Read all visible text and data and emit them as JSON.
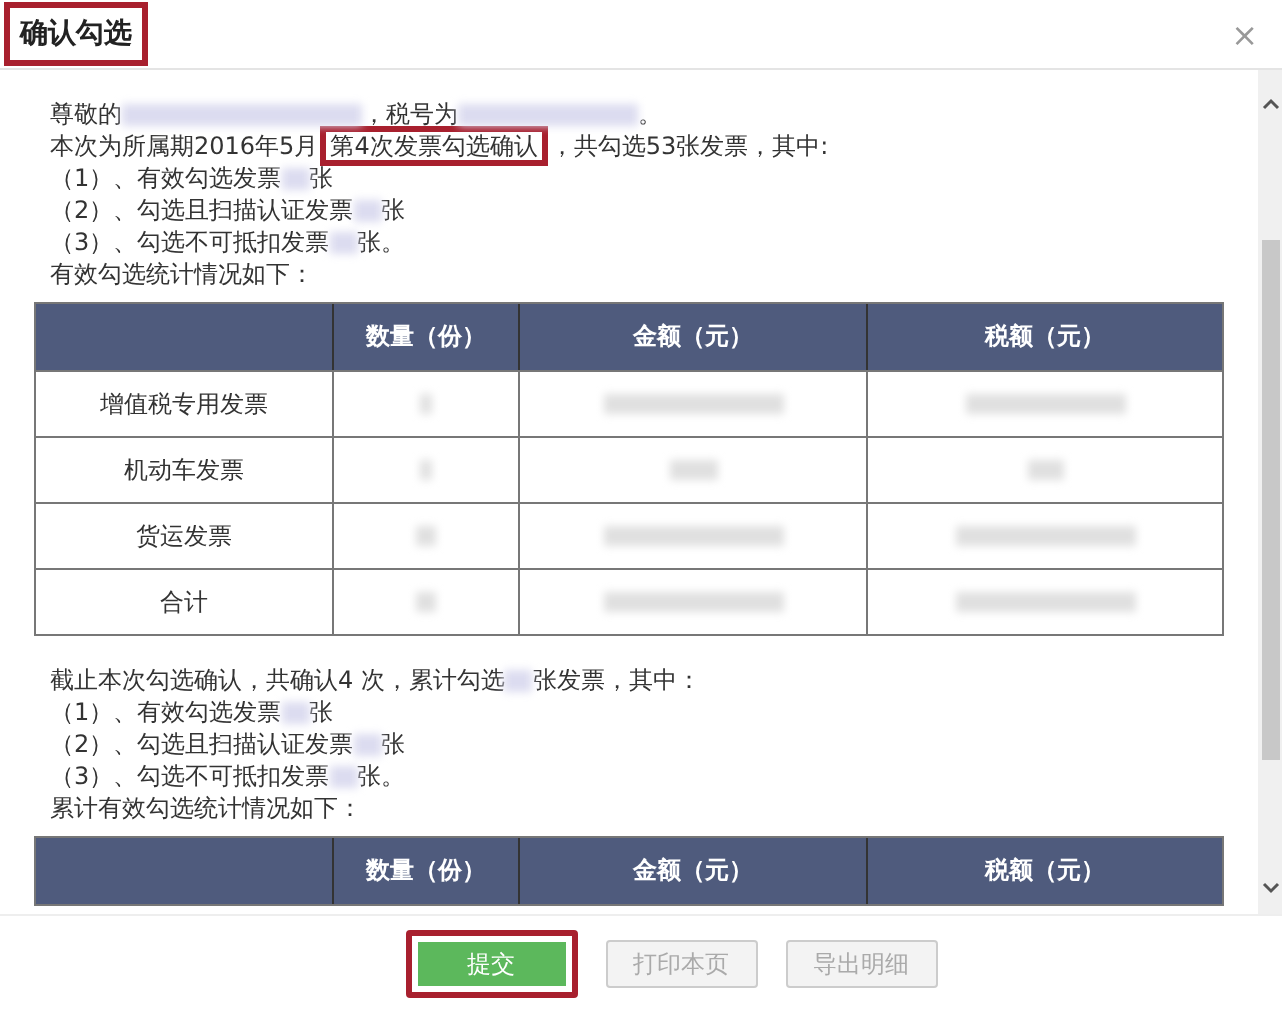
{
  "dialog": {
    "title": "确认勾选",
    "title_highlighted": true,
    "close": "×"
  },
  "section_1": {
    "lines": [
      [
        {
          "kind": "text",
          "text": "尊敬的"
        },
        {
          "kind": "redacted"
        },
        {
          "kind": "text",
          "text": "，税号为"
        },
        {
          "kind": "redacted"
        },
        {
          "kind": "text",
          "text": "。"
        }
      ],
      [
        {
          "kind": "text",
          "text": "本次为所属期2016年5月"
        },
        {
          "kind": "boxed",
          "text": "第4次发票勾选确认"
        },
        {
          "kind": "text",
          "text": "，共勾选53张发票，其中:"
        }
      ],
      [
        {
          "kind": "text",
          "text": "（1）、有效勾选发票"
        },
        {
          "kind": "redacted"
        },
        {
          "kind": "text",
          "text": "张"
        }
      ],
      [
        {
          "kind": "text",
          "text": "（2）、勾选且扫描认证发票"
        },
        {
          "kind": "redacted"
        },
        {
          "kind": "text",
          "text": "张"
        }
      ],
      [
        {
          "kind": "text",
          "text": "（3）、勾选不可抵扣发票"
        },
        {
          "kind": "redacted"
        },
        {
          "kind": "text",
          "text": "张。"
        }
      ],
      [
        {
          "kind": "text",
          "text": "有效勾选统计情况如下："
        }
      ]
    ],
    "table": {
      "columns": [
        {
          "label": "数量（份）"
        },
        {
          "label": "金额（元）"
        },
        {
          "label": "税额（元）"
        }
      ],
      "rows": [
        {
          "label": "增值税专用发票"
        },
        {
          "label": "机动车发票"
        },
        {
          "label": "货运发票"
        },
        {
          "label": "合计"
        }
      ]
    }
  },
  "section_2": {
    "lines": [
      [
        {
          "kind": "text",
          "text": "截止本次勾选确认，共确认4 次，累计勾选"
        },
        {
          "kind": "redacted"
        },
        {
          "kind": "text",
          "text": "张发票，其中："
        }
      ],
      [
        {
          "kind": "text",
          "text": "（1）、有效勾选发票"
        },
        {
          "kind": "redacted"
        },
        {
          "kind": "text",
          "text": "张"
        }
      ],
      [
        {
          "kind": "text",
          "text": "（2）、勾选且扫描认证发票"
        },
        {
          "kind": "redacted"
        },
        {
          "kind": "text",
          "text": "张"
        }
      ],
      [
        {
          "kind": "text",
          "text": "（3）、勾选不可抵扣发票"
        },
        {
          "kind": "redacted"
        },
        {
          "kind": "text",
          "text": "张。"
        }
      ],
      [
        {
          "kind": "text",
          "text": "累计有效勾选统计情况如下："
        }
      ]
    ],
    "table": {
      "columns": [
        {
          "label": "数量（份）"
        },
        {
          "label": "金额（元）"
        },
        {
          "label": "税额（元）"
        }
      ]
    }
  },
  "buttons": [
    {
      "label": "提交",
      "kind": "primary",
      "highlighted": true
    },
    {
      "label": "打印本页",
      "kind": "secondary",
      "highlighted": false
    },
    {
      "label": "导出明细",
      "kind": "secondary",
      "highlighted": false
    }
  ]
}
